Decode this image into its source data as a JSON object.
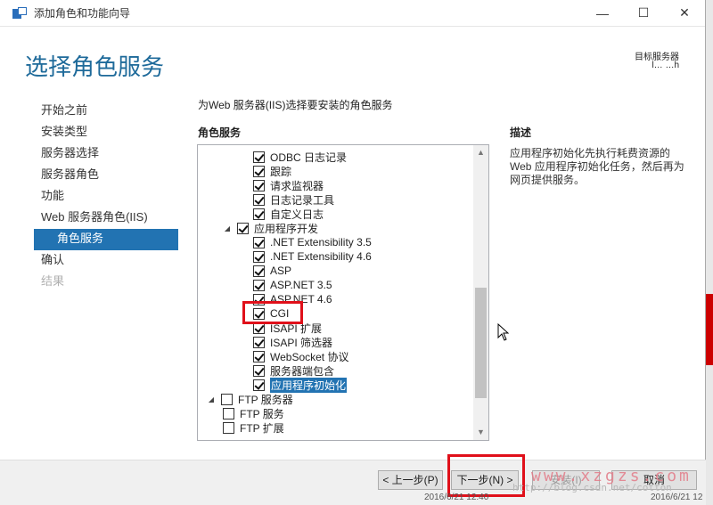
{
  "window": {
    "title": "添加角色和功能向导"
  },
  "header": {
    "page_title": "选择角色服务",
    "target_label": "目标服务器",
    "target_value": "l… …h"
  },
  "nav": {
    "items": [
      {
        "label": "开始之前",
        "state": "normal"
      },
      {
        "label": "安装类型",
        "state": "normal"
      },
      {
        "label": "服务器选择",
        "state": "normal"
      },
      {
        "label": "服务器角色",
        "state": "normal"
      },
      {
        "label": "功能",
        "state": "normal"
      },
      {
        "label": "Web 服务器角色(IIS)",
        "state": "normal"
      },
      {
        "label": "角色服务",
        "state": "active"
      },
      {
        "label": "确认",
        "state": "normal"
      },
      {
        "label": "结果",
        "state": "disabled"
      }
    ]
  },
  "main": {
    "instruction": "为Web 服务器(IIS)选择要安装的角色服务",
    "list_heading": "角色服务",
    "desc_heading": "描述",
    "desc_text": "应用程序初始化先执行耗费资源的 Web 应用程序初始化任务，然后再为网页提供服务。"
  },
  "tree": [
    {
      "label": "ODBC 日志记录",
      "checked": true,
      "indent": 2,
      "expander": ""
    },
    {
      "label": "跟踪",
      "checked": true,
      "indent": 2,
      "expander": ""
    },
    {
      "label": "请求监视器",
      "checked": true,
      "indent": 2,
      "expander": ""
    },
    {
      "label": "日志记录工具",
      "checked": true,
      "indent": 2,
      "expander": ""
    },
    {
      "label": "自定义日志",
      "checked": true,
      "indent": 2,
      "expander": ""
    },
    {
      "label": "应用程序开发",
      "checked": true,
      "indent": 1,
      "expander": "◢"
    },
    {
      "label": ".NET Extensibility 3.5",
      "checked": true,
      "indent": 2,
      "expander": ""
    },
    {
      "label": ".NET Extensibility 4.6",
      "checked": true,
      "indent": 2,
      "expander": ""
    },
    {
      "label": "ASP",
      "checked": true,
      "indent": 2,
      "expander": ""
    },
    {
      "label": "ASP.NET 3.5",
      "checked": true,
      "indent": 2,
      "expander": ""
    },
    {
      "label": "ASP.NET 4.6",
      "checked": true,
      "indent": 2,
      "expander": ""
    },
    {
      "label": "CGI",
      "checked": true,
      "indent": 2,
      "expander": ""
    },
    {
      "label": "ISAPI 扩展",
      "checked": true,
      "indent": 2,
      "expander": ""
    },
    {
      "label": "ISAPI 筛选器",
      "checked": true,
      "indent": 2,
      "expander": ""
    },
    {
      "label": "WebSocket 协议",
      "checked": true,
      "indent": 2,
      "expander": ""
    },
    {
      "label": "服务器端包含",
      "checked": true,
      "indent": 2,
      "expander": ""
    },
    {
      "label": "应用程序初始化",
      "checked": true,
      "indent": 2,
      "expander": "",
      "selected": true
    },
    {
      "label": "FTP 服务器",
      "checked": false,
      "indent": 0,
      "expander": "◢"
    },
    {
      "label": "FTP 服务",
      "checked": false,
      "indent": 1,
      "expander": ""
    },
    {
      "label": "FTP 扩展",
      "checked": false,
      "indent": 1,
      "expander": ""
    }
  ],
  "buttons": {
    "prev": "< 上一步(P)",
    "next": "下一步(N) >",
    "install": "安装(I)",
    "cancel": "取消"
  },
  "watermark": {
    "site": "www.xzgzs.com",
    "blog": "http://blog.csdn.net/cotton"
  },
  "dates": {
    "left": "2016/6/21 12:40",
    "right": "2016/6/21 12"
  }
}
